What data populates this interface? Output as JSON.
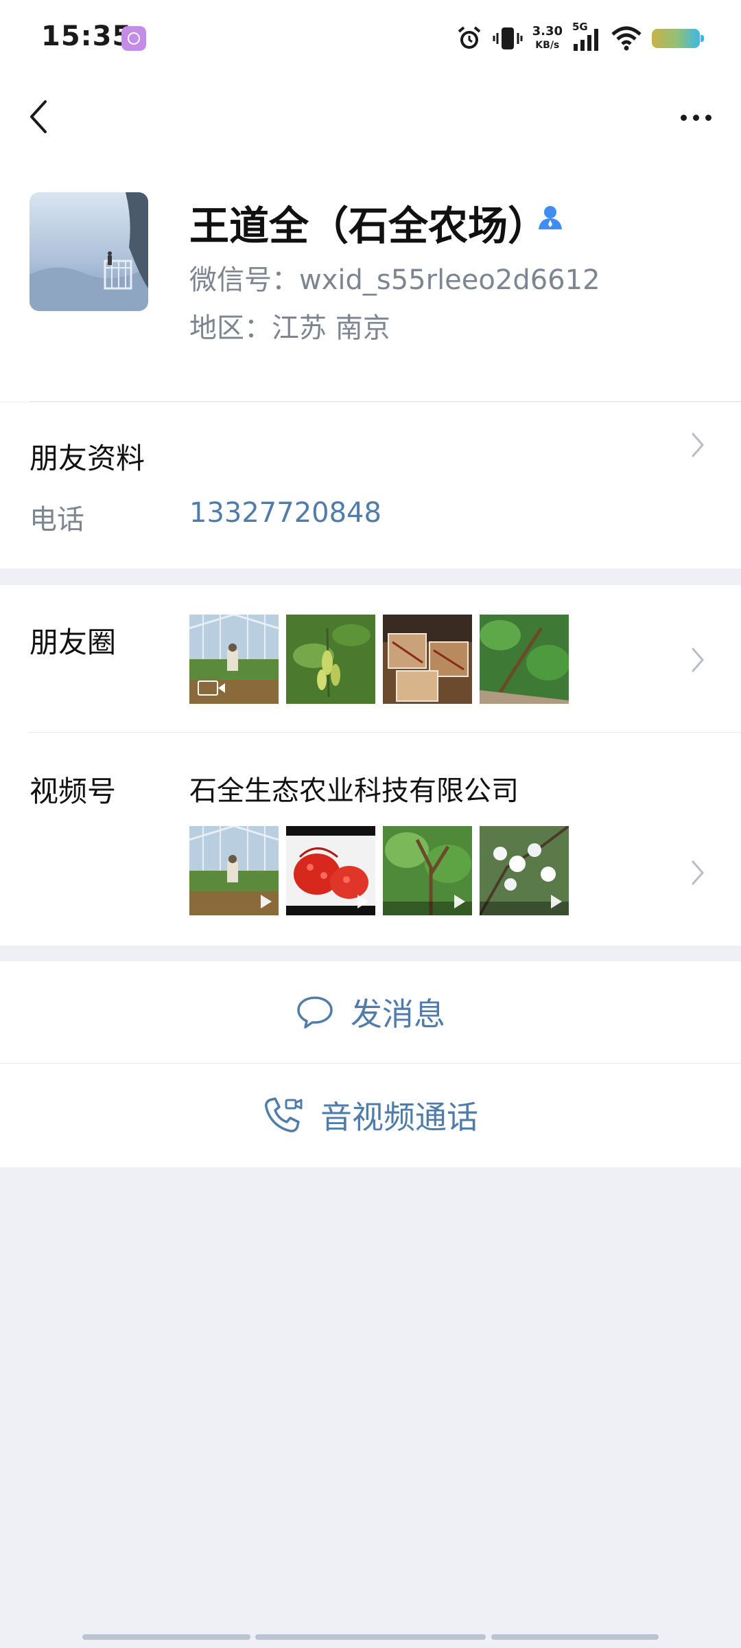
{
  "status_bar": {
    "time": "15:35",
    "net_speed": "3.30",
    "net_speed_unit": "KB/s",
    "signal_label": "5G",
    "icons": [
      "app-badge-icon",
      "alarm-icon",
      "vibrate-icon",
      "signal-icon",
      "wifi-icon",
      "battery-icon"
    ]
  },
  "nav": {
    "back_icon": "chevron-left-icon",
    "more_icon": "more-dots-icon"
  },
  "profile": {
    "name": "王道全（石全农场）",
    "wechat_id": "微信号：wxid_s55rleeo2d6612",
    "region": "地区：江苏  南京",
    "badge_icon": "person-icon",
    "badge_color": "#3f8cf2"
  },
  "friend_info": {
    "title": "朋友资料",
    "phone_label": "电话",
    "phone_value": "13327720848"
  },
  "moments": {
    "title": "朋友圈",
    "thumbnails": [
      "greenhouse-photo",
      "green-fruit-photo",
      "boxed-produce-photo",
      "tree-branch-photo"
    ]
  },
  "channels": {
    "title": "视频号",
    "name": "石全生态农业科技有限公司",
    "thumbnails": [
      "greenhouse-video",
      "red-berries-video",
      "green-tree-video",
      "white-blossom-video"
    ]
  },
  "actions": {
    "message_label": "发消息",
    "call_label": "音视频通话"
  },
  "colors": {
    "accent": "#4f7cab",
    "muted_text": "#7c8590",
    "background": "#eef0f5"
  }
}
